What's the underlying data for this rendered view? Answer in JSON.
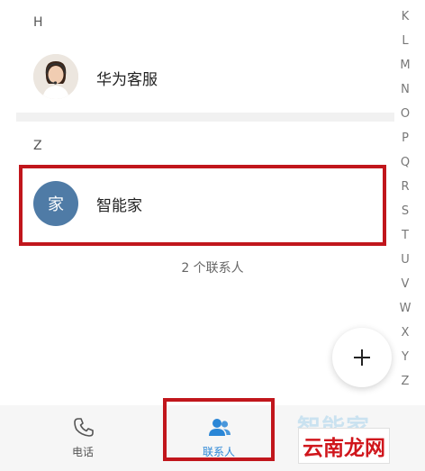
{
  "sections": [
    {
      "letter": "H",
      "contact": "华为客服"
    },
    {
      "letter": "Z",
      "contact": "智能家",
      "avatar_text": "家"
    }
  ],
  "contact_count": "2 个联系人",
  "alphabet_index": [
    "K",
    "L",
    "M",
    "N",
    "O",
    "P",
    "Q",
    "R",
    "S",
    "T",
    "U",
    "V",
    "W",
    "X",
    "Y",
    "Z"
  ],
  "fab": {
    "icon": "plus-icon"
  },
  "bottom_nav": {
    "phone_label": "电话",
    "contacts_label": "联系人",
    "active_color": "#2a86d6"
  },
  "watermark": {
    "top_text": "智能家",
    "main_text": "云南龙网"
  },
  "colors": {
    "highlight": "#c1161c",
    "avatar": "#4f7ba6"
  }
}
